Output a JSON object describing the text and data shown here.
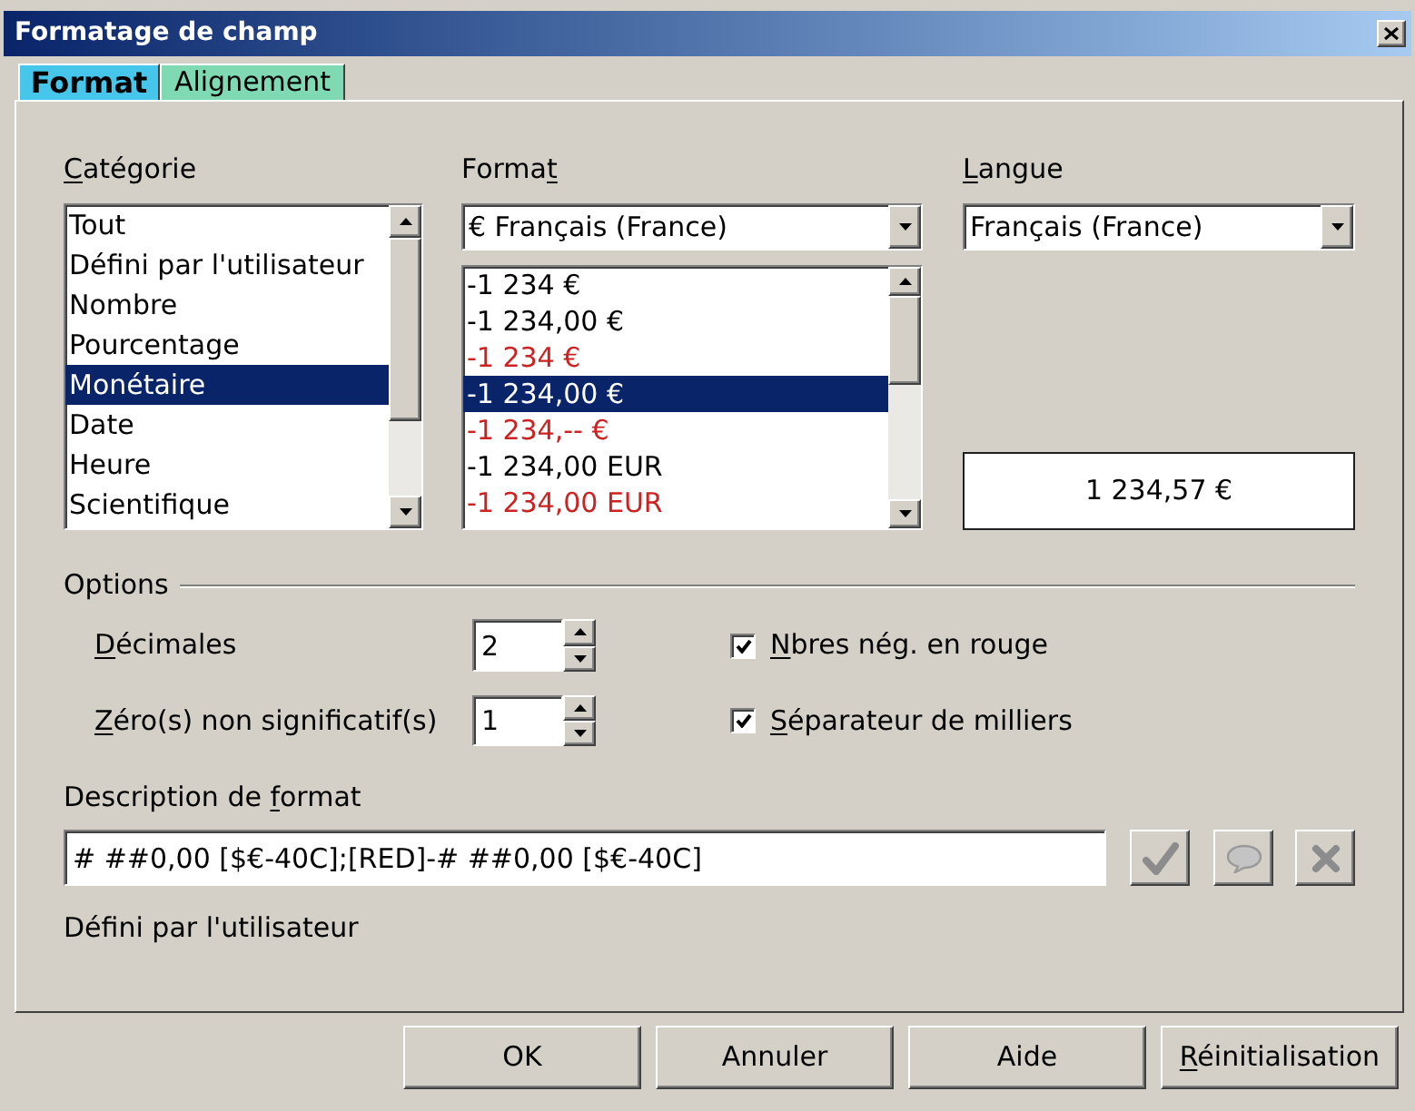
{
  "window": {
    "title": "Formatage de champ"
  },
  "tabs": [
    {
      "label": "Format",
      "selected": true
    },
    {
      "label": "Alignement",
      "selected": false
    }
  ],
  "category": {
    "label": "Catégorie",
    "mnemonic_first": true,
    "items": [
      {
        "label": "Tout",
        "selected": false
      },
      {
        "label": "Défini par l'utilisateur",
        "selected": false
      },
      {
        "label": "Nombre",
        "selected": false
      },
      {
        "label": "Pourcentage",
        "selected": false
      },
      {
        "label": "Monétaire",
        "selected": true
      },
      {
        "label": "Date",
        "selected": false
      },
      {
        "label": "Heure",
        "selected": false
      },
      {
        "label": "Scientifique",
        "selected": false
      }
    ]
  },
  "format": {
    "label": "Format",
    "mnemonic_last": true,
    "dropdown": {
      "value": "€ Français (France)"
    },
    "items": [
      {
        "label": "-1 234 €",
        "red": false,
        "selected": false
      },
      {
        "label": "-1 234,00 €",
        "red": false,
        "selected": false
      },
      {
        "label": "-1 234 €",
        "red": true,
        "selected": false
      },
      {
        "label": "-1 234,00 €",
        "red": false,
        "selected": true
      },
      {
        "label": "-1 234,-- €",
        "red": true,
        "selected": false
      },
      {
        "label": "-1 234,00 EUR",
        "red": false,
        "selected": false
      },
      {
        "label": "-1 234,00 EUR",
        "red": true,
        "selected": false
      }
    ]
  },
  "language": {
    "label": "Langue",
    "mnemonic_first": true,
    "dropdown": {
      "value": "Français (France)"
    }
  },
  "preview": {
    "value": "1 234,57 €"
  },
  "options": {
    "title": "Options",
    "spinners": [
      {
        "label": "Décimales",
        "mnemonic_first": true,
        "value": "2"
      },
      {
        "label": "Zéro(s) non significatif(s)",
        "mnemonic_first": true,
        "value": "1"
      }
    ],
    "checkboxes": [
      {
        "label": "Nbres nég. en rouge",
        "mnemonic_first": true,
        "checked": true
      },
      {
        "label": "Séparateur de milliers",
        "mnemonic_first": true,
        "checked": true
      }
    ]
  },
  "format_code": {
    "label": "Description de format",
    "mnemonic_last_word": true,
    "value": "# ##0,00 [$€-40C];[RED]-# ##0,00 [$€-40C]",
    "tool_buttons": [
      {
        "kind": "add",
        "disabled": true
      },
      {
        "kind": "comment",
        "disabled": true
      },
      {
        "kind": "delete",
        "disabled": true
      }
    ]
  },
  "comment": "Défini par l'utilisateur",
  "buttons": [
    {
      "label": "OK"
    },
    {
      "label": "Annuler"
    },
    {
      "label": "Aide"
    },
    {
      "label": "Réinitialisation",
      "mnemonic_first": true
    }
  ]
}
